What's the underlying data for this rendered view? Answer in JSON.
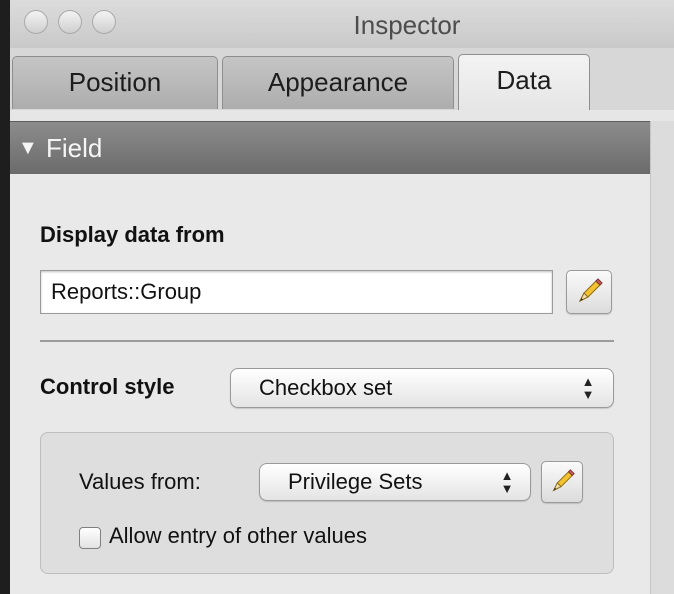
{
  "window": {
    "title": "Inspector"
  },
  "tabs": [
    {
      "label": "Position",
      "active": false
    },
    {
      "label": "Appearance",
      "active": false
    },
    {
      "label": "Data",
      "active": true
    }
  ],
  "section": {
    "disclosure": "▼",
    "title": "Field"
  },
  "field": {
    "display_data_label": "Display data from",
    "display_data_value": "Reports::Group",
    "control_style_label": "Control style",
    "control_style_value": "Checkbox set",
    "values_from_label": "Values from:",
    "values_from_value": "Privilege Sets",
    "allow_entry_label": "Allow entry of other values",
    "allow_entry_checked": false
  },
  "icons": {
    "edit": "pencil-icon",
    "popup_arrows": "updown-arrows-icon",
    "disclosure": "triangle-down-icon"
  },
  "colors": {
    "section_header": "#7a7a7a",
    "window_bg": "#e6e6e6"
  }
}
